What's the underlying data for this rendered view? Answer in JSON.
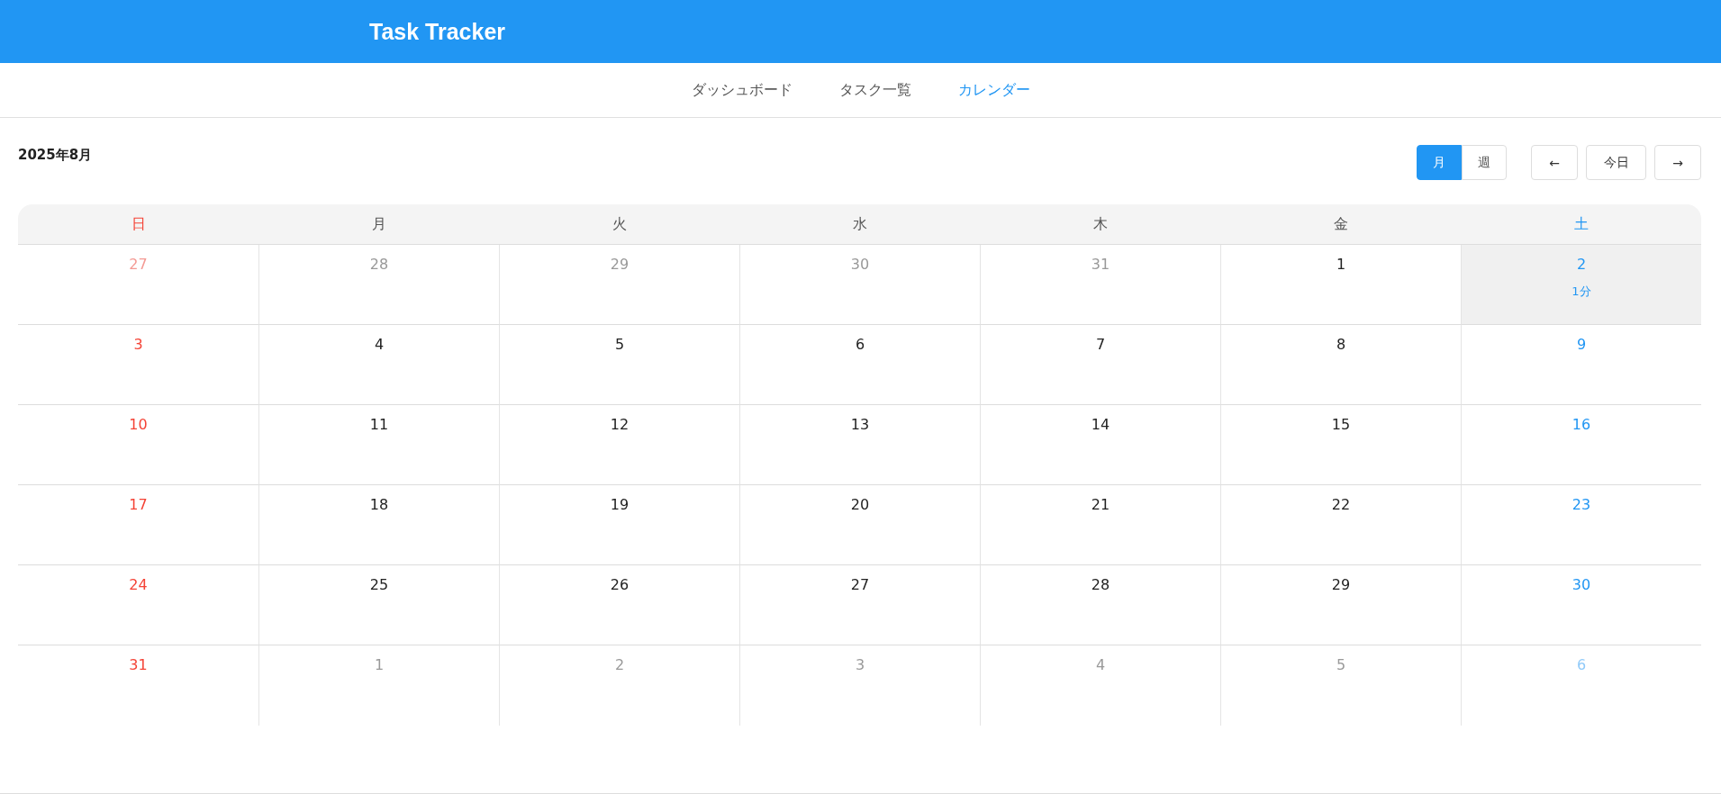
{
  "app": {
    "title": "Task Tracker"
  },
  "nav": [
    {
      "label": "ダッシュボード",
      "selected": false
    },
    {
      "label": "タスク一覧",
      "selected": false
    },
    {
      "label": "カレンダー",
      "selected": true
    }
  ],
  "calendar": {
    "title": "2025年8月",
    "views": [
      {
        "label": "月",
        "selected": true
      },
      {
        "label": "週",
        "selected": false
      }
    ],
    "prev": "←",
    "today": "今日",
    "next": "→",
    "weekdays": [
      "日",
      "月",
      "火",
      "水",
      "木",
      "金",
      "土"
    ],
    "weeks": [
      [
        {
          "day": "27",
          "in_month": false,
          "selected": false
        },
        {
          "day": "28",
          "in_month": false,
          "selected": false
        },
        {
          "day": "29",
          "in_month": false,
          "selected": false
        },
        {
          "day": "30",
          "in_month": false,
          "selected": false
        },
        {
          "day": "31",
          "in_month": false,
          "selected": false
        },
        {
          "day": "1",
          "in_month": true,
          "selected": false
        },
        {
          "day": "2",
          "in_month": true,
          "selected": true,
          "events": [
            "1分"
          ]
        }
      ],
      [
        {
          "day": "3",
          "in_month": true,
          "selected": false
        },
        {
          "day": "4",
          "in_month": true,
          "selected": false
        },
        {
          "day": "5",
          "in_month": true,
          "selected": false
        },
        {
          "day": "6",
          "in_month": true,
          "selected": false
        },
        {
          "day": "7",
          "in_month": true,
          "selected": false
        },
        {
          "day": "8",
          "in_month": true,
          "selected": false
        },
        {
          "day": "9",
          "in_month": true,
          "selected": false
        }
      ],
      [
        {
          "day": "10",
          "in_month": true,
          "selected": false
        },
        {
          "day": "11",
          "in_month": true,
          "selected": false
        },
        {
          "day": "12",
          "in_month": true,
          "selected": false
        },
        {
          "day": "13",
          "in_month": true,
          "selected": false
        },
        {
          "day": "14",
          "in_month": true,
          "selected": false
        },
        {
          "day": "15",
          "in_month": true,
          "selected": false
        },
        {
          "day": "16",
          "in_month": true,
          "selected": false
        }
      ],
      [
        {
          "day": "17",
          "in_month": true,
          "selected": false
        },
        {
          "day": "18",
          "in_month": true,
          "selected": false
        },
        {
          "day": "19",
          "in_month": true,
          "selected": false
        },
        {
          "day": "20",
          "in_month": true,
          "selected": false
        },
        {
          "day": "21",
          "in_month": true,
          "selected": false
        },
        {
          "day": "22",
          "in_month": true,
          "selected": false
        },
        {
          "day": "23",
          "in_month": true,
          "selected": false
        }
      ],
      [
        {
          "day": "24",
          "in_month": true,
          "selected": false
        },
        {
          "day": "25",
          "in_month": true,
          "selected": false
        },
        {
          "day": "26",
          "in_month": true,
          "selected": false
        },
        {
          "day": "27",
          "in_month": true,
          "selected": false
        },
        {
          "day": "28",
          "in_month": true,
          "selected": false
        },
        {
          "day": "29",
          "in_month": true,
          "selected": false
        },
        {
          "day": "30",
          "in_month": true,
          "selected": false
        }
      ],
      [
        {
          "day": "31",
          "in_month": true,
          "selected": false
        },
        {
          "day": "1",
          "in_month": false,
          "selected": false
        },
        {
          "day": "2",
          "in_month": false,
          "selected": false
        },
        {
          "day": "3",
          "in_month": false,
          "selected": false
        },
        {
          "day": "4",
          "in_month": false,
          "selected": false
        },
        {
          "day": "5",
          "in_month": false,
          "selected": false
        },
        {
          "day": "6",
          "in_month": false,
          "selected": false
        }
      ]
    ]
  }
}
